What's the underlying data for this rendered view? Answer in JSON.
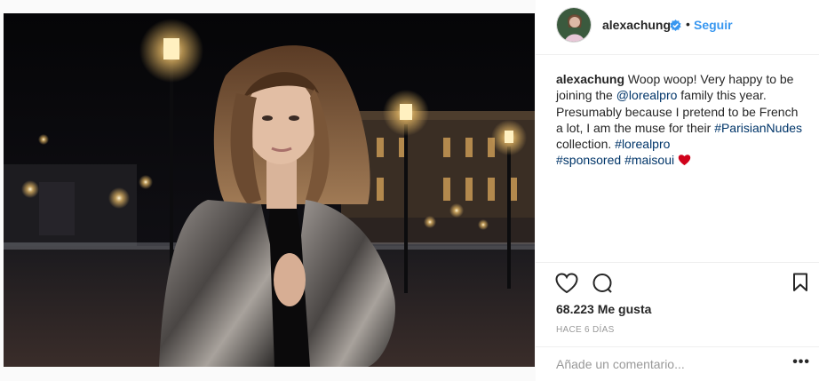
{
  "post": {
    "photo_alt": "alexachung",
    "username": "alexachung",
    "follow_label": "Seguir",
    "separator": "•",
    "caption": {
      "user": "alexachung",
      "t1": " Woop woop! Very happy to be joining the ",
      "mention": "@lorealpro",
      "t2": " family this year. Presumably because I pretend to be French a lot, I am the muse for their ",
      "tag1": "#ParisianNudes",
      "t3": " collection. ",
      "tag2": "#lorealpro",
      "tag3": "#sponsored",
      "tag4": "#maisoui"
    },
    "likes": "68.223 Me gusta",
    "time": "HACE 6 DÍAS",
    "comment_placeholder": "Añade un comentario...",
    "more_label": "•••"
  },
  "icons": {
    "verified": "verified-badge-icon",
    "like": "heart-outline-icon",
    "comment": "speech-bubble-icon",
    "save": "bookmark-icon",
    "emoji": "red-heart-emoji-icon"
  },
  "colors": {
    "link": "#003569",
    "follow": "#3897f0",
    "verified": "#3897f0",
    "muted": "#999999",
    "text": "#262626"
  }
}
